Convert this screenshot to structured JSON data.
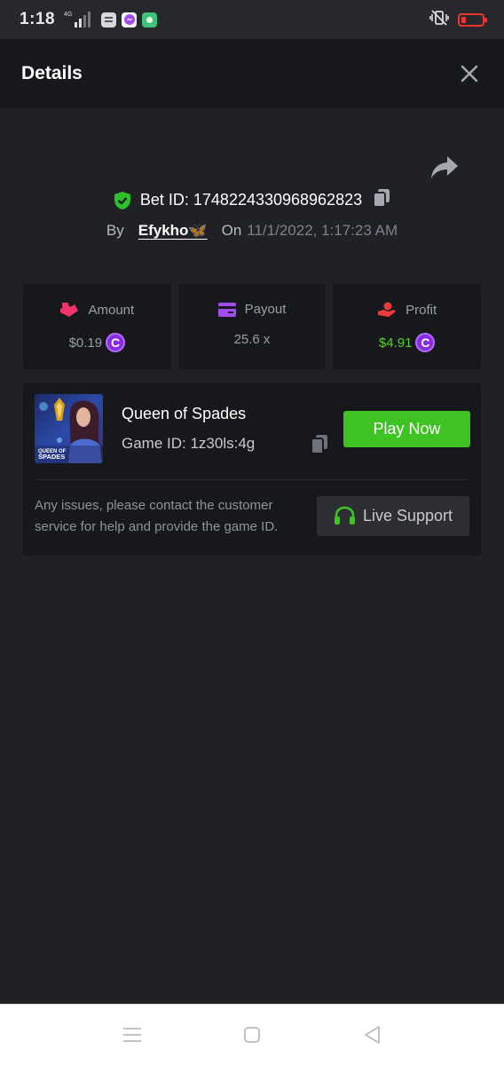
{
  "status_bar": {
    "time": "1:18",
    "network": "4G"
  },
  "header": {
    "title": "Details"
  },
  "bet": {
    "id_label": "Bet ID: 1748224330968962823",
    "by_label": "By",
    "username": "Efykho🦋",
    "on_label": "On",
    "date": "11/1/2022, 1:17:23 AM"
  },
  "stats": {
    "amount": {
      "label": "Amount",
      "value": "$0.19"
    },
    "payout": {
      "label": "Payout",
      "value": "25.6 x"
    },
    "profit": {
      "label": "Profit",
      "value": "$4.91"
    },
    "coin_symbol": "C"
  },
  "game": {
    "name": "Queen of Spades",
    "id_label": "Game ID: 1z30ls:4g",
    "thumb_title_line1": "QUEEN OF",
    "thumb_title_line2": "SPADES",
    "play_label": "Play Now",
    "issue_text": "Any issues, please contact the customer service for help and provide the game ID.",
    "support_label": "Live Support"
  },
  "colors": {
    "background": "#202124",
    "panel": "#17181b",
    "play_green": "#3ec422",
    "profit_green": "#4dd522",
    "coin_purple": "#8a2be2"
  }
}
